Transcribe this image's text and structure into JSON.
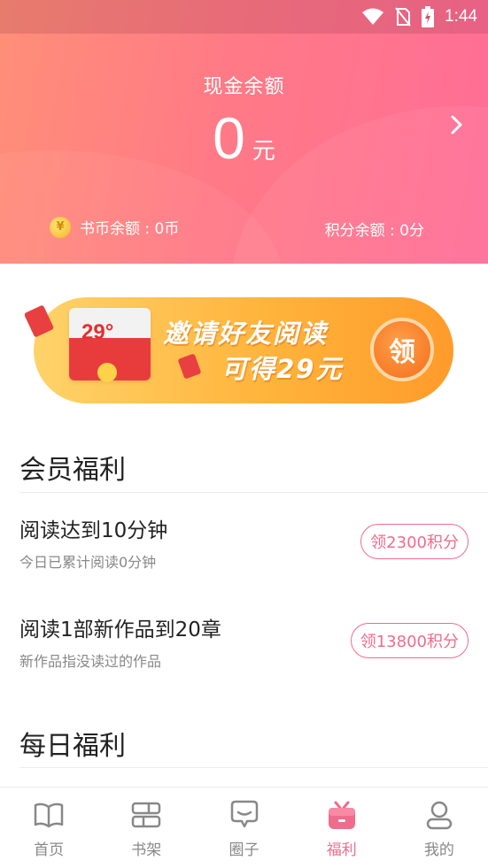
{
  "status": {
    "time": "1:44"
  },
  "balance": {
    "title": "现金余额",
    "amount": "0",
    "unit": "元",
    "coin_label": "书币余额 : 0币",
    "points_label": "积分余额 : 0分"
  },
  "banner": {
    "envelope_value": "29°",
    "line1": "邀请好友阅读",
    "line2": "可得29元",
    "claim_label": "领"
  },
  "member": {
    "title": "会员福利",
    "tasks": [
      {
        "title": "阅读达到10分钟",
        "subtitle": "今日已累计阅读0分钟",
        "button": "领2300积分"
      },
      {
        "title": "阅读1部新作品到20章",
        "subtitle": "新作品指没读过的作品",
        "button": "领13800积分"
      }
    ]
  },
  "daily": {
    "title": "每日福利"
  },
  "nav": {
    "items": [
      {
        "label": "首页",
        "icon": "book-open-icon"
      },
      {
        "label": "书架",
        "icon": "bookshelf-icon"
      },
      {
        "label": "圈子",
        "icon": "chat-bubble-icon"
      },
      {
        "label": "福利",
        "icon": "gift-icon"
      },
      {
        "label": "我的",
        "icon": "user-icon"
      }
    ],
    "active_index": 3
  },
  "colors": {
    "accent": "#f06c8c",
    "header_start": "#ff8f78",
    "header_end": "#ff6d97"
  }
}
